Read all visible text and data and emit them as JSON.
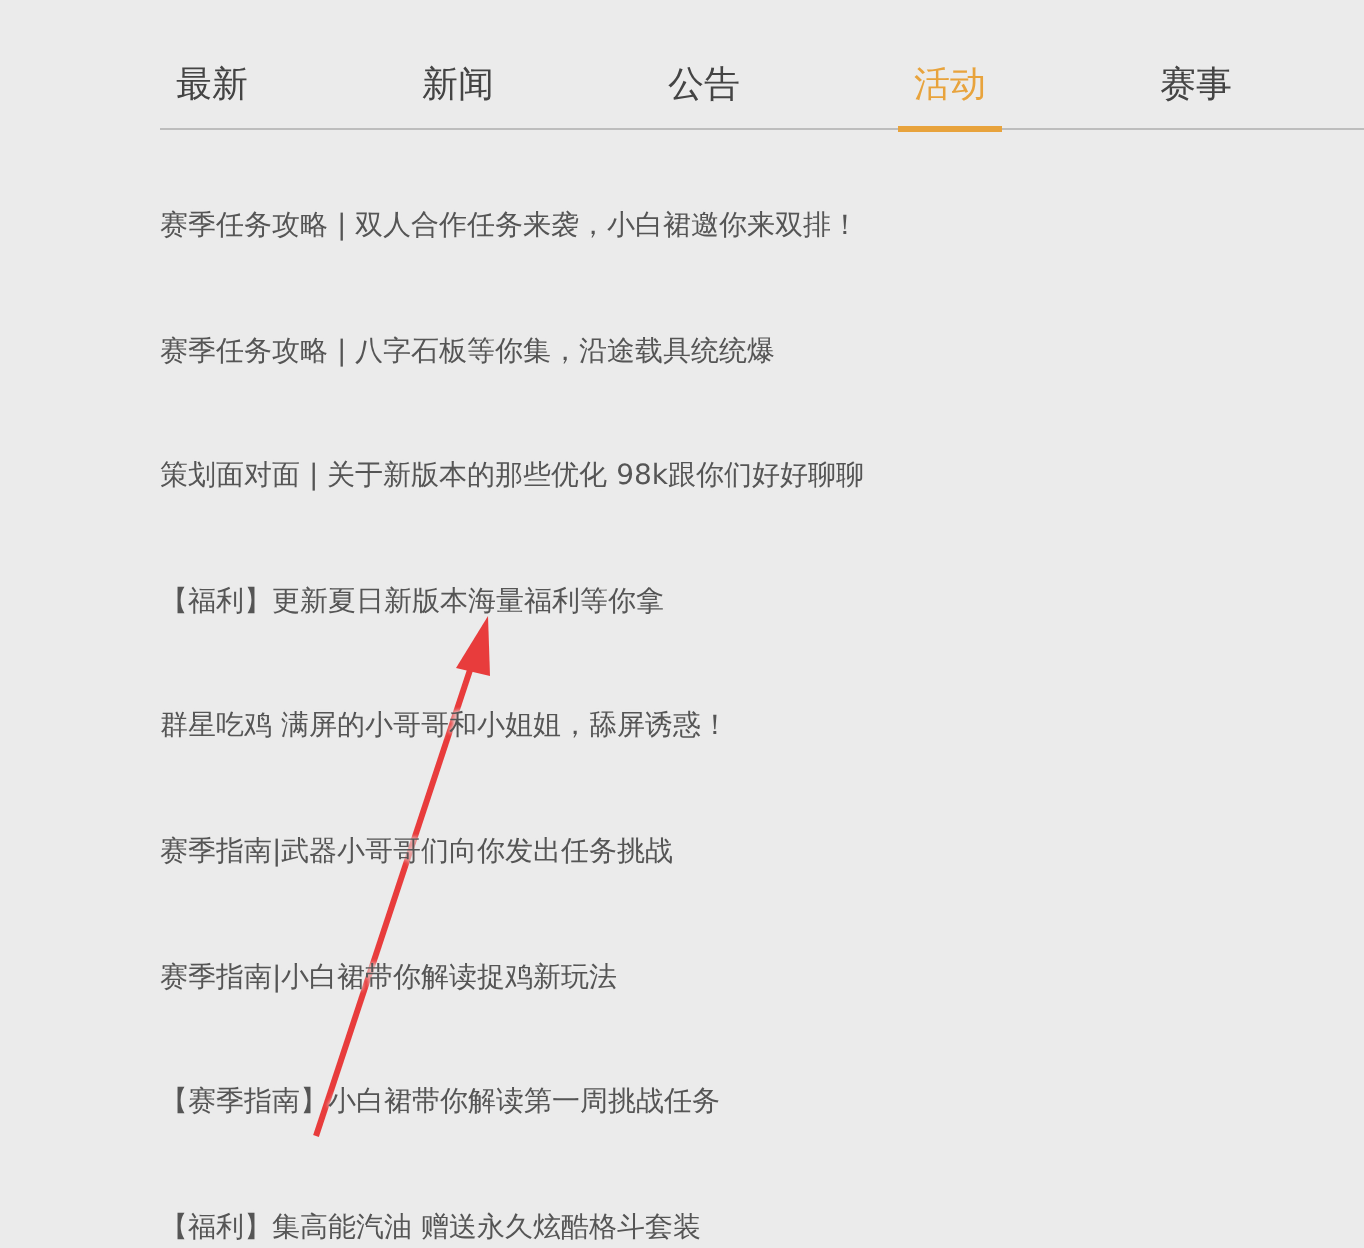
{
  "tabs": [
    {
      "label": "最新",
      "selected": false
    },
    {
      "label": "新闻",
      "selected": false
    },
    {
      "label": "公告",
      "selected": false
    },
    {
      "label": "活动",
      "selected": true
    },
    {
      "label": "赛事",
      "selected": false
    }
  ],
  "articles": [
    {
      "title": "赛季任务攻略 | 双人合作任务来袭，小白裙邀你来双排！"
    },
    {
      "title": "赛季任务攻略 | 八字石板等你集，沿途载具统统爆"
    },
    {
      "title": "策划面对面 | 关于新版本的那些优化 98k跟你们好好聊聊"
    },
    {
      "title": "【福利】更新夏日新版本海量福利等你拿"
    },
    {
      "title": "群星吃鸡 满屏的小哥哥和小姐姐，舔屏诱惑！"
    },
    {
      "title": "赛季指南|武器小哥哥们向你发出任务挑战"
    },
    {
      "title": "赛季指南|小白裙带你解读捉鸡新玩法"
    },
    {
      "title": "【赛季指南】小白裙带你解读第一周挑战任务"
    },
    {
      "title": "【福利】集高能汽油 赠送永久炫酷格斗套装"
    }
  ]
}
